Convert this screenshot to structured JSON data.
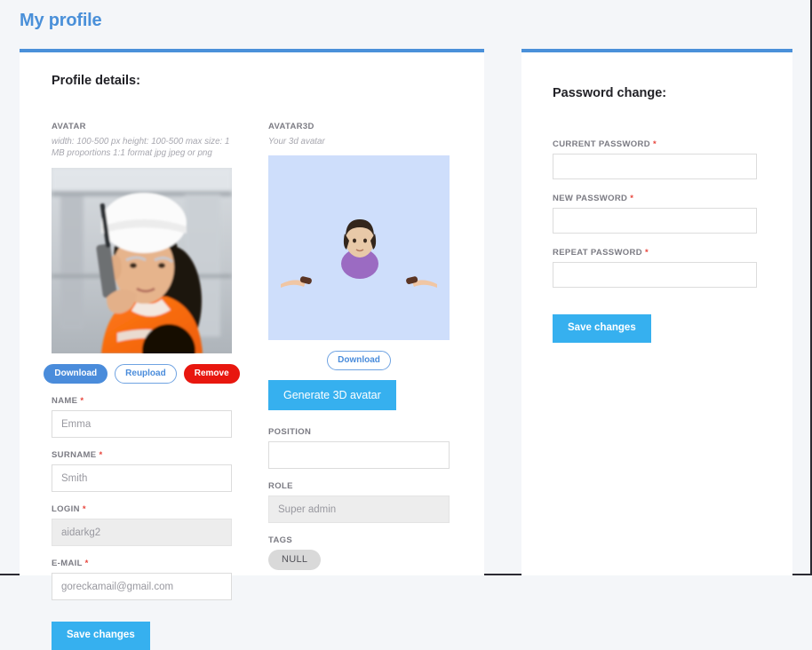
{
  "page": {
    "title": "My profile",
    "accent_color": "#4a90d9",
    "background_color": "#f4f6f9",
    "button_color": "#36b0ef"
  },
  "profile_card": {
    "heading": "Profile details:",
    "avatar": {
      "label": "AVATAR",
      "hint": "width: 100-500 px height: 100-500 max size: 1 MB proportions 1:1 format jpg jpeg or png",
      "image_alt": "worker-with-hard-hat-photo",
      "buttons": {
        "download": "Download",
        "reupload": "Reupload",
        "remove": "Remove"
      }
    },
    "avatar3d": {
      "label": "AVATAR3D",
      "hint": "Your 3d avatar",
      "canvas_color": "#cedefb",
      "download_label": "Download",
      "generate_label": "Generate 3D avatar"
    },
    "fields": {
      "name": {
        "label": "NAME",
        "required": true,
        "value": "Emma",
        "disabled": false
      },
      "surname": {
        "label": "SURNAME",
        "required": true,
        "value": "Smith",
        "disabled": false
      },
      "login": {
        "label": "LOGIN",
        "required": true,
        "value": "aidarkg2",
        "disabled": true
      },
      "email": {
        "label": "E-MAIL",
        "required": true,
        "value": "goreckamail@gmail.com",
        "disabled": false
      },
      "position": {
        "label": "POSITION",
        "required": false,
        "value": "",
        "disabled": false
      },
      "role": {
        "label": "ROLE",
        "required": false,
        "value": "Super admin",
        "disabled": true
      },
      "tags": {
        "label": "TAGS",
        "chip": "NULL"
      }
    },
    "save_label": "Save changes"
  },
  "password_card": {
    "heading": "Password change:",
    "fields": {
      "current": {
        "label": "CURRENT PASSWORD",
        "required": true,
        "value": ""
      },
      "new": {
        "label": "NEW PASSWORD",
        "required": true,
        "value": ""
      },
      "repeat": {
        "label": "REPEAT PASSWORD",
        "required": true,
        "value": ""
      }
    },
    "save_label": "Save changes"
  }
}
